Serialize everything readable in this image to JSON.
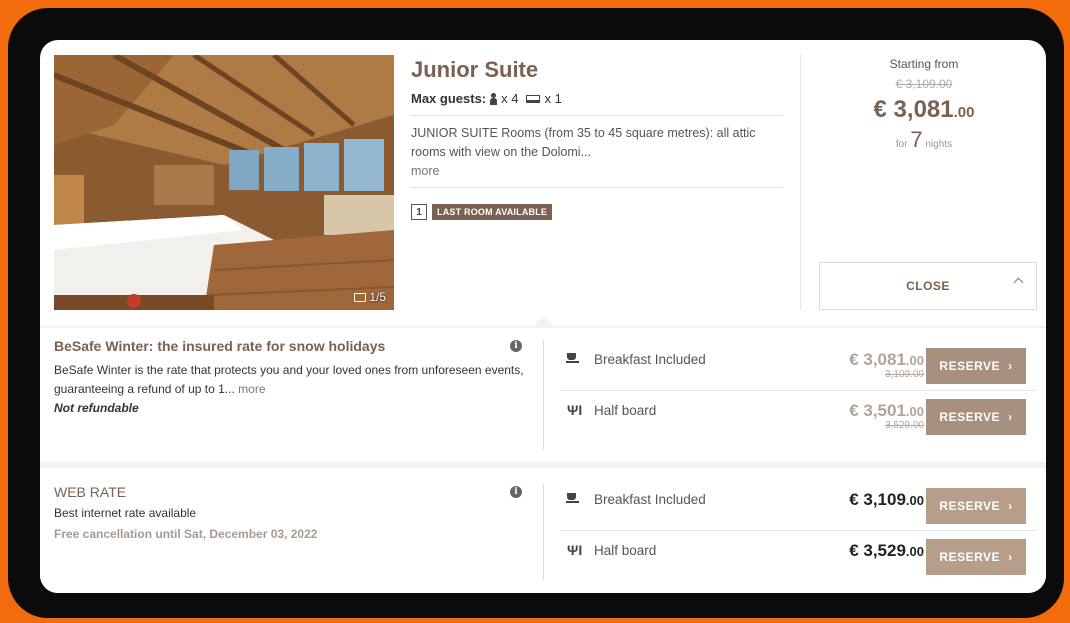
{
  "room": {
    "title": "Junior Suite",
    "guests_label": "Max guests:",
    "guests_count": "x 4",
    "beds_count": "x 1",
    "description": "JUNIOR SUITE Rooms (from 35 to 45 square metres): all attic rooms with view on the Dolomi...",
    "more_label": "more",
    "availability_count": "1",
    "availability_label": "LAST ROOM AVAILABLE",
    "photo_counter": "1/5"
  },
  "price": {
    "starting_label": "Starting from",
    "old_price": "€ 3,109.00",
    "price_int": "€ 3,081",
    "price_dec": ".00",
    "for_label": "for",
    "nights_num": "7",
    "nights_label": "nights"
  },
  "close_label": "CLOSE",
  "rates": [
    {
      "name": "BeSafe Winter: the insured rate for snow holidays",
      "description": "BeSafe Winter is the rate that protects you and your loved ones from unforeseen events, guaranteeing a refund of up to 1...",
      "more_label": "more",
      "policy": "Not refundable",
      "boards": [
        {
          "label": "Breakfast Included",
          "price_int": "€ 3,081",
          "price_dec": ".00",
          "old_price": "3,109.00",
          "button": "RESERVE"
        },
        {
          "label": "Half board",
          "price_int": "€ 3,501",
          "price_dec": ".00",
          "old_price": "3,529.00",
          "button": "RESERVE"
        }
      ]
    },
    {
      "name": "WEB RATE",
      "description": "Best internet rate available",
      "policy": "Free cancellation until Sat, December 03, 2022",
      "boards": [
        {
          "label": "Breakfast Included",
          "price_int": "€ 3,109",
          "price_dec": ".00",
          "button": "RESERVE"
        },
        {
          "label": "Half board",
          "price_int": "€ 3,529",
          "price_dec": ".00",
          "button": "RESERVE"
        }
      ]
    }
  ],
  "colors": {
    "accent_brown": "#7a6152",
    "button_brown": "#a8907e",
    "outer_orange": "#f26b0c"
  }
}
